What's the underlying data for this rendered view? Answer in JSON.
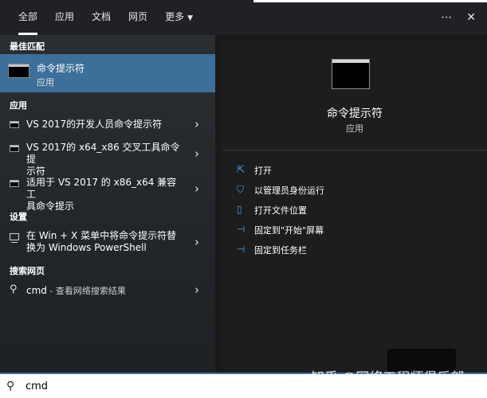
{
  "tabs": [
    {
      "label": "全部"
    },
    {
      "label": "应用"
    },
    {
      "label": "文档"
    },
    {
      "label": "网页"
    },
    {
      "label": "更多"
    }
  ],
  "top_actions": {
    "more_icon": "⋯",
    "close_icon": "✕"
  },
  "left": {
    "best_match_title": "最佳匹配",
    "best_match": {
      "name": "命令提示符",
      "type": "应用"
    },
    "apps_title": "应用",
    "apps": [
      {
        "line1": "VS 2017的开发人员命令提示符",
        "line2": ""
      },
      {
        "line1": "VS 2017的 x64_x86 交叉工具命令提",
        "line2": "示符"
      },
      {
        "line1": "适用于 VS 2017 的 x86_x64 兼容工",
        "line2": "具命令提示"
      }
    ],
    "settings_title": "设置",
    "settings": [
      {
        "line1": "在 Win + X 菜单中将命令提示符替",
        "line2": "换为 Windows PowerShell"
      }
    ],
    "web_title": "搜索网页",
    "web": {
      "query": "cmd",
      "suffix": " - 查看网络搜索结果"
    }
  },
  "preview": {
    "title": "命令提示符",
    "subtitle": "应用",
    "actions": [
      {
        "icon": "open-icon",
        "label": "打开"
      },
      {
        "icon": "run-as-admin-icon",
        "label": "以管理员身份运行"
      },
      {
        "icon": "file-location-icon",
        "label": "打开文件位置"
      },
      {
        "icon": "pin-start-icon",
        "label": "固定到\"开始\"屏幕"
      },
      {
        "icon": "pin-taskbar-icon",
        "label": "固定到任务栏"
      }
    ]
  },
  "search": {
    "value": "cmd"
  },
  "watermark": "知乎 @网络工程师俱乐部",
  "colors": {
    "accent": "#3c6f99",
    "action_icon": "#4aa0e6"
  }
}
